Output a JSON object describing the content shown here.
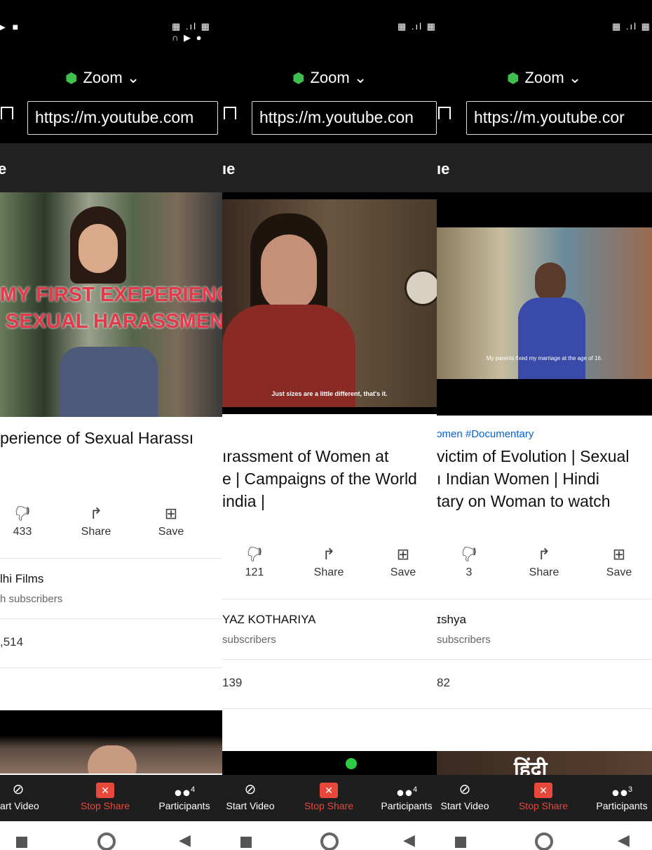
{
  "colors": {
    "shield": "#3fbf4f",
    "stop_share": "#e8473c",
    "hashtag": "#065fd4"
  },
  "panels": [
    {
      "zoom_title": "Zoom ⌄",
      "url": "https://m.youtube.com",
      "yt_logo": "e",
      "video_overlay_line1": "MY FIRST EXEPERIENCE",
      "video_overlay_line2": "SEXUAL HARASSMENT",
      "caption": "",
      "tags": "",
      "title_lines": [
        "perience of Sexual Harassı"
      ],
      "dislike_count": "433",
      "share_label": "Share",
      "save_label": "Save",
      "channel_name": "lhi Films",
      "channel_subs": "h subscribers",
      "comments": ",514",
      "controls": {
        "video": "tart Video",
        "stop": "Stop Share",
        "participants": "Participants",
        "participants_count": "4"
      }
    },
    {
      "zoom_title": "Zoom ⌄",
      "url": "https://m.youtube.con",
      "yt_logo": "ıe",
      "caption": "Just sizes are a little different, that's it.",
      "tags": "",
      "title_lines": [
        "ırassment of Women at",
        "e | Campaigns of the World",
        "india |"
      ],
      "dislike_count": "121",
      "share_label": "Share",
      "save_label": "Save",
      "channel_name": "YAZ KOTHARIYA",
      "channel_subs": "subscribers",
      "comments": "139",
      "controls": {
        "video": "Start Video",
        "stop": "Stop Share",
        "participants": "Participants",
        "participants_count": "4"
      }
    },
    {
      "zoom_title": "Zoom ⌄",
      "url": "https://m.youtube.cor",
      "yt_logo": "ıe",
      "caption": "My parents fixed my marriage at the age of 16.",
      "tags": "ɔmen  #Documentary",
      "title_lines": [
        "victim of Evolution | Sexual",
        "ı Indian Women | Hindi",
        "tary on Woman to watch"
      ],
      "dislike_count": "3",
      "share_label": "Share",
      "save_label": "Save",
      "channel_name": "ɪshya",
      "channel_subs": "subscribers",
      "comments": "82",
      "controls": {
        "video": "Start Video",
        "stop": "Stop Share",
        "participants": "Participants",
        "participants_count": "3"
      },
      "hindi_text": "हिंदी"
    }
  ]
}
